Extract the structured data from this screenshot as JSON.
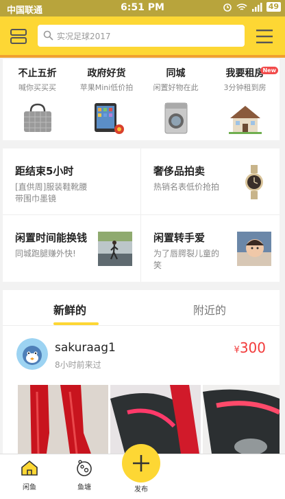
{
  "status_bar": {
    "carrier": "中国联通",
    "time": "6:51 PM",
    "battery": "49"
  },
  "header": {
    "search_placeholder": "实况足球2017"
  },
  "categories": [
    {
      "title": "不止五折",
      "subtitle": "喊你买买买",
      "image": "handbag"
    },
    {
      "title": "政府好货",
      "subtitle": "苹果Mini低价拍",
      "image": "ipad-mini"
    },
    {
      "title": "同城",
      "subtitle": "闲置好物在此",
      "image": "washing-machine"
    },
    {
      "title": "我要租房",
      "subtitle": "3分钟租到房",
      "image": "house",
      "badge": "New"
    }
  ],
  "promos": [
    {
      "title": "距结束5小时",
      "desc_line1": "[直供周]服装鞋靴腰",
      "desc_line2": "带围巾墨镜"
    },
    {
      "title": "奢侈品拍卖",
      "desc_line1": "热销名表低价抢拍",
      "image": "watch"
    },
    {
      "title": "闲置时间能换钱",
      "desc_line1": "同城跑腿赚外快!",
      "image": "runner-photo"
    },
    {
      "title": "闲置转手爱",
      "desc_line1": "为了唇腭裂儿童的",
      "desc_line2": "笑",
      "image": "child-photo"
    }
  ],
  "tabs": {
    "active": "新鲜的",
    "other": "附近的"
  },
  "feed_item": {
    "username": "sakuraag1",
    "time_ago": "8小时前来过",
    "currency": "¥",
    "price": "300",
    "photos": [
      "red-boots",
      "red-boot-sole",
      "boot-sole-closeup"
    ]
  },
  "bottom_nav": {
    "home": "闲鱼",
    "pond": "鱼塘",
    "publish": "发布"
  },
  "colors": {
    "brand_yellow": "#fdd734",
    "price_red": "#f23a3a",
    "status_bar": "#b8a43c"
  }
}
